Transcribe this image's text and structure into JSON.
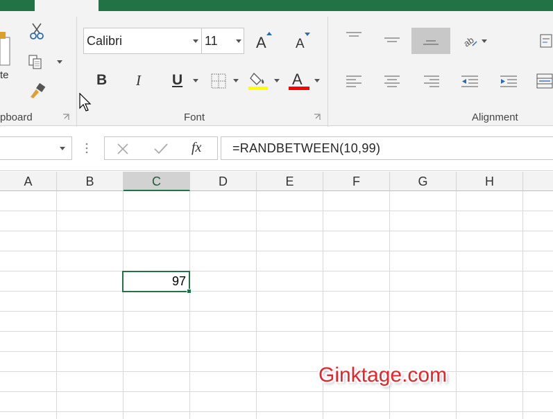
{
  "ribbon": {
    "clipboard": {
      "label": "pboard",
      "paste_fragment": "te"
    },
    "font": {
      "label": "Font",
      "font_name": "Calibri",
      "font_size": "11",
      "grow_letter": "A",
      "shrink_letter": "A",
      "bold_letter": "B",
      "italic_letter": "I",
      "underline_letter": "U",
      "font_color_letter": "A",
      "highlight_color": "#ffff00",
      "font_color": "#ff0000"
    },
    "alignment": {
      "label": "Alignment"
    }
  },
  "formula_bar": {
    "fx_label": "fx",
    "formula": "=RANDBETWEEN(10,99)"
  },
  "grid": {
    "columns": [
      "A",
      "B",
      "C",
      "D",
      "E",
      "F",
      "G",
      "H"
    ],
    "selected_column": "C",
    "selected_cell_value": "97"
  },
  "watermark": "Ginktage.com",
  "colors": {
    "accent": "#217346",
    "ribbon_bg": "#f3f3f3",
    "gridline": "#d9d9d9"
  }
}
